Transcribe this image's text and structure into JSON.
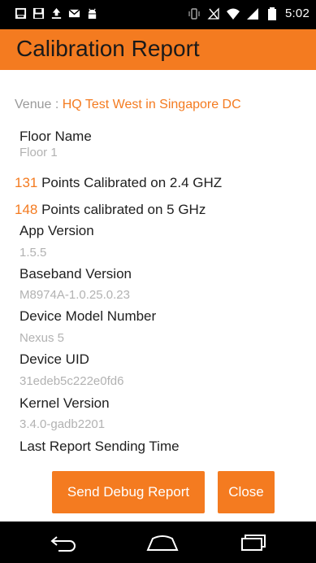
{
  "status_bar": {
    "time": "5:02",
    "left_icons": [
      "image-icon",
      "save-icon",
      "upload-icon",
      "mail-icon",
      "android-icon"
    ],
    "right_icons": [
      "vibrate-icon",
      "no-signal-icon",
      "wifi-icon",
      "signal-icon",
      "battery-icon"
    ]
  },
  "app_bar": {
    "title": "Calibration Report"
  },
  "report": {
    "venue_label": "Venue : ",
    "venue_value": "HQ Test West in Singapore DC",
    "floor_name_label": "Floor Name",
    "floor_name_value": "Floor 1",
    "points_24_count": "131",
    "points_24_text": " Points Calibrated on 2.4 GHZ",
    "points_5_count": "148",
    "points_5_text": " Points calibrated on 5 GHz",
    "app_version_label": "App Version",
    "app_version_value": "1.5.5",
    "baseband_label": "Baseband Version",
    "baseband_value": "M8974A-1.0.25.0.23",
    "model_label": "Device Model Number",
    "model_value": "Nexus 5",
    "uid_label": "Device UID",
    "uid_value": "31edeb5c222e0fd6",
    "kernel_label": "Kernel Version",
    "kernel_value": "3.4.0-gadb2201",
    "last_report_label": "Last Report Sending Time"
  },
  "buttons": {
    "send_debug": "Send Debug Report",
    "close": "Close"
  },
  "nav_bar": {
    "icons": [
      "back-icon",
      "home-icon",
      "recents-icon"
    ]
  },
  "colors": {
    "accent": "#f47b20",
    "app_bar": "#f47b20",
    "status_bar": "#000000",
    "nav_bar": "#000000",
    "label_text": "#202020",
    "value_text": "#b2b2b2"
  }
}
